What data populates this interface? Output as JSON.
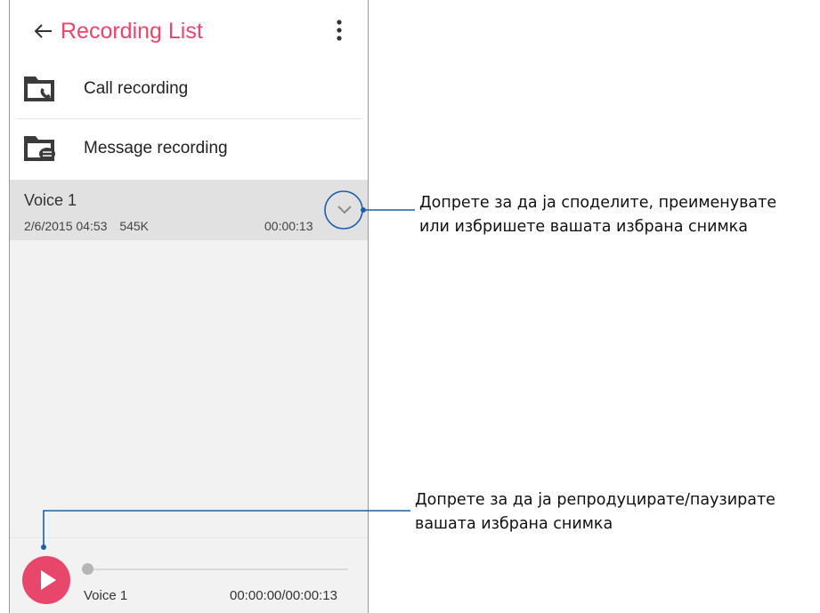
{
  "header": {
    "title": "Recording List",
    "back_icon": "back-arrow-icon",
    "menu_icon": "more-vert-icon"
  },
  "folders": [
    {
      "label": "Call recording",
      "icon": "call-folder-icon"
    },
    {
      "label": "Message recording",
      "icon": "message-folder-icon"
    }
  ],
  "recordings": [
    {
      "name": "Voice 1",
      "date": "2/6/2015 04:53",
      "size": "545K",
      "duration": "00:00:13",
      "action_icon": "chevron-down-icon"
    }
  ],
  "player": {
    "track_name": "Voice 1",
    "time": "00:00:00/00:00:13",
    "progress": 0,
    "play_icon": "play-icon"
  },
  "callouts": [
    {
      "lines": [
        "Допрете за да ја споделите, преименувате",
        "или избришете вашата избрана снимка"
      ]
    },
    {
      "lines": [
        "Допрете за да ја репродуцирате/паузирате",
        "вашата избрана снимка"
      ]
    }
  ],
  "colors": {
    "accent": "#e8466b",
    "callout_line": "#1b5fa8",
    "selected_row": "#e1e1e1",
    "background": "#f2f2f2"
  }
}
